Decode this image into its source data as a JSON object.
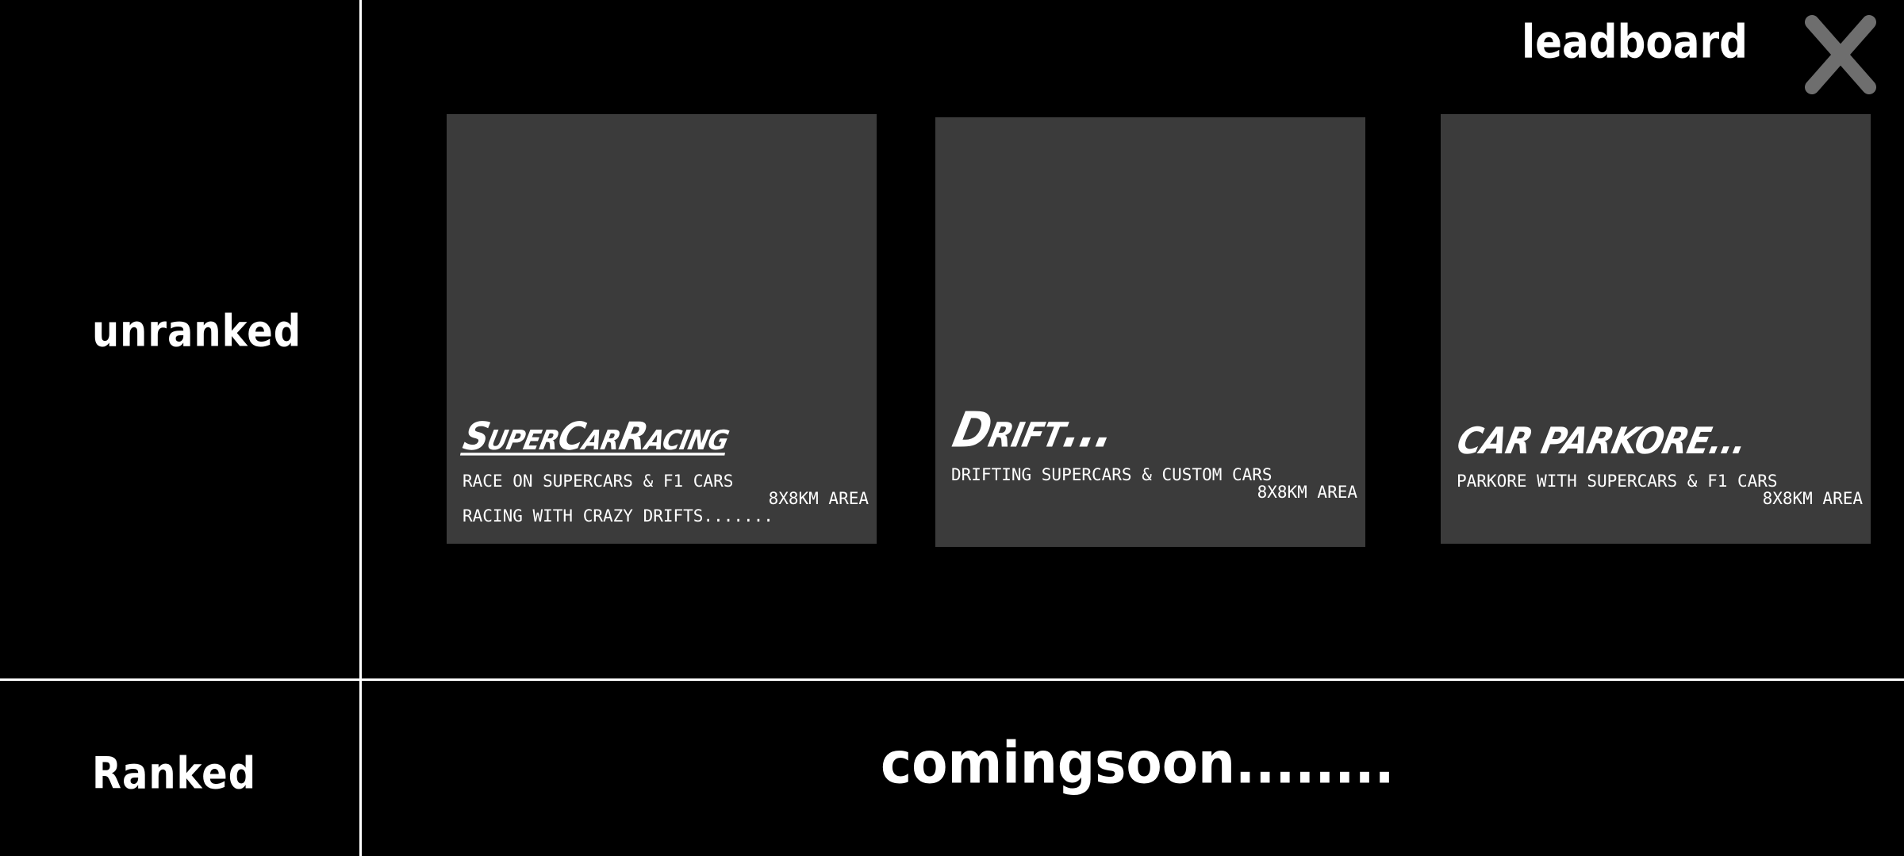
{
  "sidebar": {
    "unranked_label": "unranked",
    "ranked_label": "Ranked"
  },
  "header": {
    "leaderboard_label": "leadboard",
    "close_icon": "close-icon"
  },
  "modes": [
    {
      "title": "SuperCarRacing",
      "lines": [
        "RACE ON SUPERCARS & F1 CARS",
        "8X8KM AREA",
        "RACING WITH CRAZY DRIFTS......."
      ]
    },
    {
      "title": "Drift...",
      "lines": [
        "DRIFTING SUPERCARS & CUSTOM CARS",
        "8X8KM AREA"
      ]
    },
    {
      "title": "CAR PARKORE...",
      "lines": [
        "PARKORE WITH SUPERCARS & F1 CARS",
        "8X8KM AREA"
      ]
    }
  ],
  "ranked": {
    "status": "comingsoon........"
  },
  "colors": {
    "background": "#000000",
    "card": "#3b3b3b",
    "text": "#ffffff",
    "close_icon": "#6e6e6e"
  }
}
